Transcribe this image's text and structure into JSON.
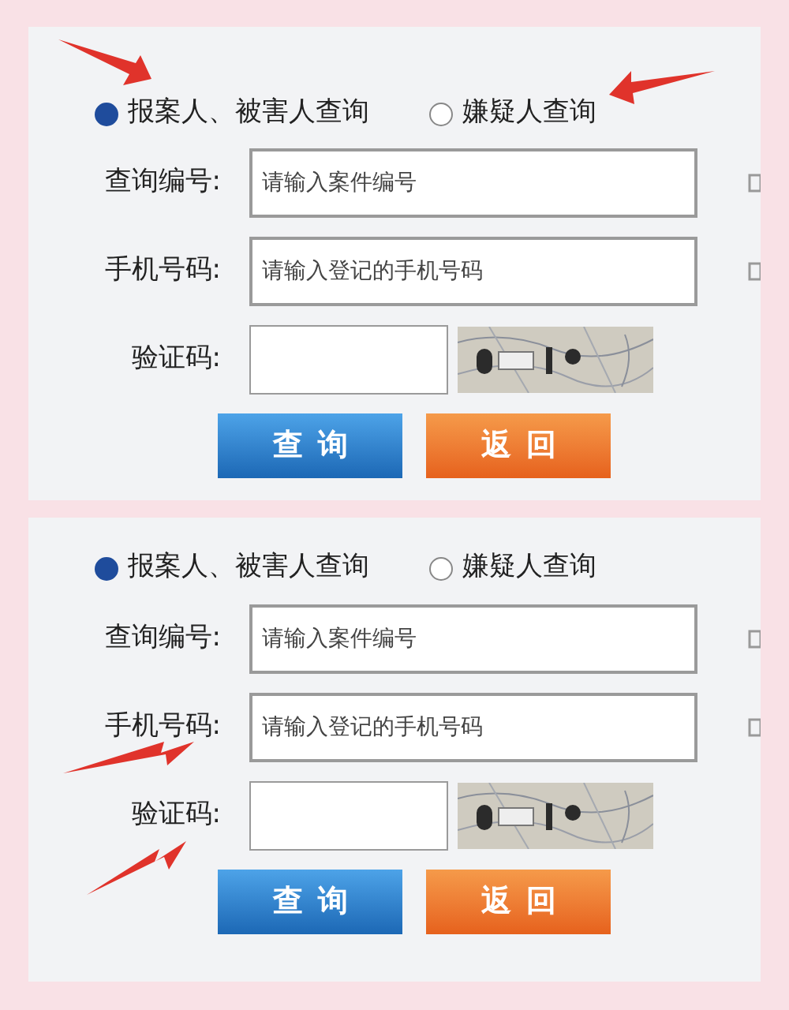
{
  "panels": [
    {
      "radios": [
        {
          "label": "报案人、被害人查询",
          "selected": true
        },
        {
          "label": "嫌疑人查询",
          "selected": false
        }
      ],
      "fields": [
        {
          "kind": "text",
          "label": "查询编号:",
          "placeholder": "请输入案件编号"
        },
        {
          "kind": "text",
          "label": "手机号码:",
          "placeholder": "请输入登记的手机号码"
        },
        {
          "kind": "captcha",
          "label": "验证码:"
        }
      ],
      "buttons": [
        {
          "kind": "primary",
          "label": "查询"
        },
        {
          "kind": "back",
          "label": "返回"
        }
      ]
    },
    {
      "radios": [
        {
          "label": "报案人、被害人查询",
          "selected": true
        },
        {
          "label": "嫌疑人查询",
          "selected": false
        }
      ],
      "fields": [
        {
          "kind": "text",
          "label": "查询编号:",
          "placeholder": "请输入案件编号"
        },
        {
          "kind": "text",
          "label": "手机号码:",
          "placeholder": "请输入登记的手机号码"
        },
        {
          "kind": "captcha",
          "label": "验证码:"
        }
      ],
      "buttons": [
        {
          "kind": "primary",
          "label": "查询"
        },
        {
          "kind": "back",
          "label": "返回"
        }
      ]
    }
  ]
}
